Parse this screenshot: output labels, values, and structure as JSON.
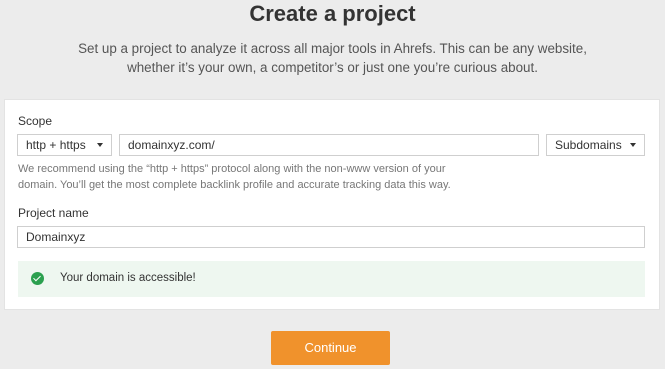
{
  "header": {
    "title": "Create a project",
    "subtitle_line1": "Set up a project to analyze it across all major tools in Ahrefs. This can be any website,",
    "subtitle_line2": "whether it’s your own, a competitor’s or just one you’re curious about."
  },
  "scope": {
    "label": "Scope",
    "protocol": "http + https",
    "domain": "domainxyz.com/",
    "mode": "Subdomains",
    "hint_line1": "We recommend using the “http + https” protocol along with the non-www version of your",
    "hint_line2": "domain. You’ll get the most complete backlink profile and accurate tracking data this way."
  },
  "project": {
    "label": "Project name",
    "name": "Domainxyz"
  },
  "status": {
    "message": "Your domain is accessible!",
    "color": "#2ba04f"
  },
  "actions": {
    "continue_label": "Continue",
    "accent": "#f0922c"
  }
}
